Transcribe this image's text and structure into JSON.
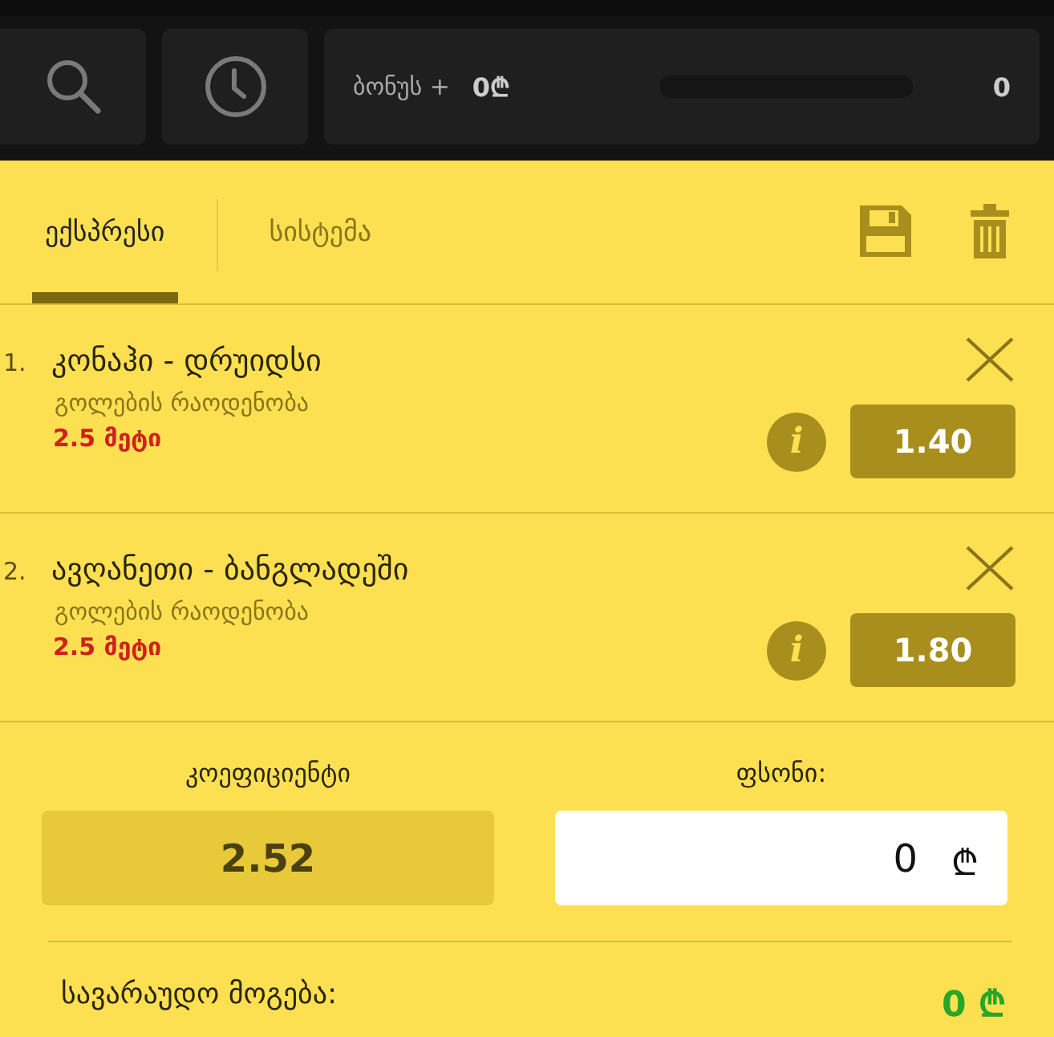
{
  "top_bar": {
    "bonus_label": "ბონუს +",
    "bonus_amount": "0₾",
    "bonus_progress": {
      "level": 0
    },
    "bonus_count": "0"
  },
  "tabs": [
    {
      "label": "ექსპრესი",
      "selected": true
    },
    {
      "label": "სისტემა",
      "selected": false
    }
  ],
  "bets": [
    {
      "number": "1.",
      "match": "კონაჰი - დრუიდსი",
      "market": "გოლების რაოდენობა",
      "selection": "2.5 მეტი",
      "info": "i",
      "odds": "1.40"
    },
    {
      "number": "2.",
      "match": "ავღანეთი - ბანგლადეში",
      "market": "გოლების რაოდენობა",
      "selection": "2.5 მეტი",
      "info": "i",
      "odds": "1.80"
    }
  ],
  "summary": {
    "coefficient_label": "კოეფიციენტი",
    "coefficient": "2.52",
    "stake_label": "ფსონი:",
    "stake": "0",
    "currency": "₾",
    "potential_win_label": "სავარაუდო მოგება:",
    "potential_win": "0 ₾"
  }
}
